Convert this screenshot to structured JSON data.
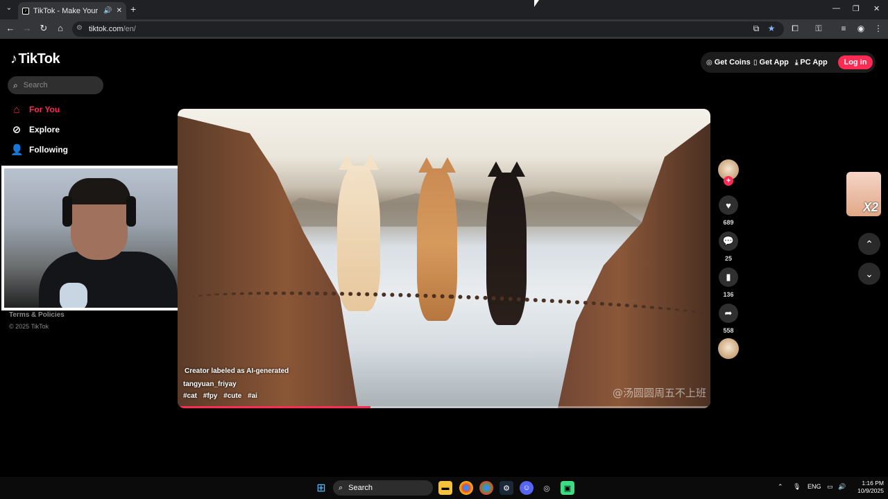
{
  "browser": {
    "tab_title": "TikTok - Make Your Day",
    "url_host": "tiktok.com",
    "url_path": "/en/"
  },
  "sidebar": {
    "logo": "TikTok",
    "search_placeholder": "Search",
    "items": [
      {
        "label": "For You",
        "icon": "home-icon",
        "active": true
      },
      {
        "label": "Explore",
        "icon": "compass-icon"
      },
      {
        "label": "Following",
        "icon": "following-icon"
      }
    ],
    "footer_links": "Terms & Policies",
    "copyright": "© 2025 TikTok"
  },
  "header": {
    "get_coins": "Get Coins",
    "get_app": "Get App",
    "pc_app": "PC App",
    "login": "Log in"
  },
  "video": {
    "ai_label": "Creator labeled as AI-generated",
    "author": "tangyuan_friyay",
    "hashtags": [
      "#cat",
      "#fpy",
      "#cute",
      "#ai"
    ],
    "watermark": "@汤圆圆周五不上班",
    "progress": 0.36
  },
  "actions": {
    "likes": "689",
    "comments": "25",
    "saves": "136",
    "shares": "558"
  },
  "promo": {
    "badge": "X2"
  },
  "taskbar": {
    "search_label": "Search",
    "lang": "ENG",
    "time": "1:16 PM",
    "date": "10/9/2025"
  },
  "colors": {
    "accent": "#fe2c55",
    "background": "#000000"
  }
}
